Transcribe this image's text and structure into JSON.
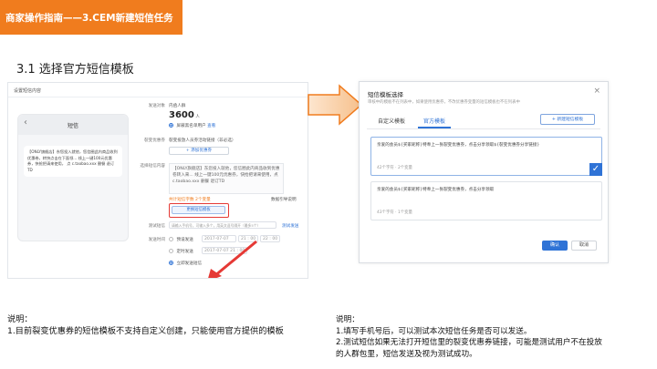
{
  "header": {
    "title": "商家操作指南——3.CEM新建短信任务",
    "section": "3.1 选择官方短信模板",
    "accent_color": "#f07c1e"
  },
  "left_screenshot": {
    "panel_title": "设置短信内容",
    "phone": {
      "back_icon": "chevron-left-icon",
      "title": "短信",
      "message": "【ONLY旗舰店】东您投入就他，您信圈此内商品收到优惠卷，转快点击在下面领... 线上一键100元优惠券，快抢把请来使用， 点 c.taobao.xxx 删餐 退订TD"
    },
    "form": {
      "send_target_label": "发送对象",
      "send_target_value": "内函人群",
      "count_value": "3600",
      "count_unit": "人",
      "exclude_label": "屏蔽黑名单用户",
      "exclude_link": "查看",
      "benefit_label": "裂变优惠券",
      "benefit_value": "裂变投放人员券活动链接（非必选）",
      "add_benefit": "+ 添加优惠券",
      "template_label": "选择短信内容",
      "template_text": "【ONLY旗舰店】东您投入就他，您信圈此内商品收到优惠卷转入来... 线上一键100元优惠券，快抢把请来使用，点 c.taobao.xxx 删餐 退订TD",
      "char_count": "共计短信字数 2个变量",
      "char_link": "数据引导说明",
      "pick_template_button": "更换短信模板",
      "test_label": "测试短信",
      "test_placeholder": "请输入手机号，可输入多个，用英文逗号隔开（最多5个）",
      "test_link": "测试发送",
      "time_label": "发送时间",
      "time_option_1": "预设发送",
      "time_date_1": "2017-07-07",
      "time_hour_1": "21 : 00",
      "time_min_1": "22 : 00",
      "time_option_2": "定时发送",
      "time_date_2": "2017-07-07 21 : 00",
      "time_option_3": "立即发送短信"
    }
  },
  "dialog": {
    "title": "短信模板选择",
    "subtitle": "审核中的模板不在列表中，如果使用优惠券，不改优惠券变量的短信模板也不在列表中",
    "tabs": [
      "自定义模板",
      "官方模板"
    ],
    "active_tab": 1,
    "new_button": "+ 新建短信模板",
    "templates": [
      {
        "text": "亲爱的会员${买家昵称}特奉上一张裂变优惠券，点击分享领取${裂变优惠券分享链接}",
        "meta": "42个字符 · 2个变量",
        "selected": true
      },
      {
        "text": "亲爱的会员${买家昵称}特奉上一张裂变优惠券，点击分享领取",
        "meta": "43个字符 · 1个变量",
        "selected": false
      }
    ],
    "ok_button": "确认",
    "cancel_button": "取消"
  },
  "notes": {
    "left": [
      "说明：",
      "1.目前裂变优惠券的短信模板不支持自定义创建，只能使用官方提供的模板"
    ],
    "right": [
      "说明：",
      "1.填写手机号后，可以测试本次短信任务是否可以发送。",
      "2.测试短信如果无法打开短信里的裂变优惠券链接，可能是测试用户不在投放",
      "的人群包里，短信发送及视为测试成功。"
    ]
  }
}
